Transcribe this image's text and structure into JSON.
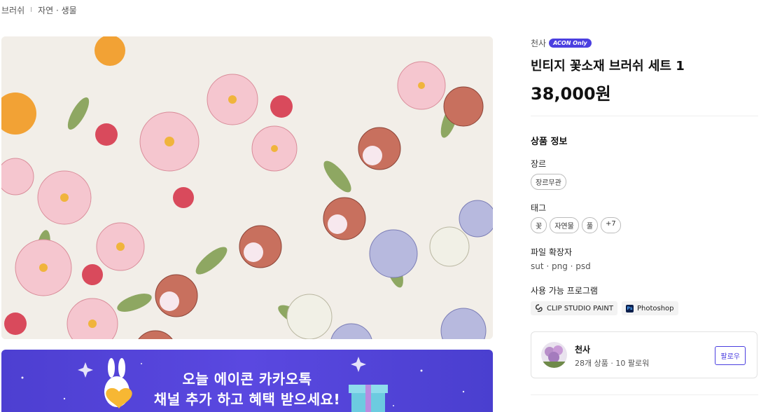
{
  "breadcrumb": {
    "category": "브러쉬",
    "separator": "I",
    "subcategory": "자연 · 생물"
  },
  "product": {
    "seller": "천사",
    "badge": "ACON Only",
    "title": "빈티지 꽃소재 브러쉬 세트 1",
    "price": "38,000원"
  },
  "info": {
    "section_title": "상품 정보",
    "genre_label": "장르",
    "genre_chips": [
      "장르무관"
    ],
    "tag_label": "태그",
    "tag_chips": [
      "꽃",
      "자연물",
      "풀",
      "+7"
    ],
    "ext_label": "파일 확장자",
    "extensions": "sut · png · psd",
    "programs_label": "사용 가능 프로그램",
    "programs": [
      {
        "name": "CLIP STUDIO PAINT",
        "icon": "clip-studio-icon"
      },
      {
        "name": "Photoshop",
        "icon": "photoshop-icon",
        "icon_text": "Ps"
      }
    ]
  },
  "seller_card": {
    "name": "천사",
    "stats": "28개 상품 · 10 팔로워",
    "follow_label": "팔로우"
  },
  "banner": {
    "line1": "오늘 에이콘 카카오톡",
    "line2": "채널 추가 하고 혜택 받으세요!"
  },
  "colors": {
    "accent": "#4b3fe0",
    "banner_bg": "#5546dc"
  }
}
